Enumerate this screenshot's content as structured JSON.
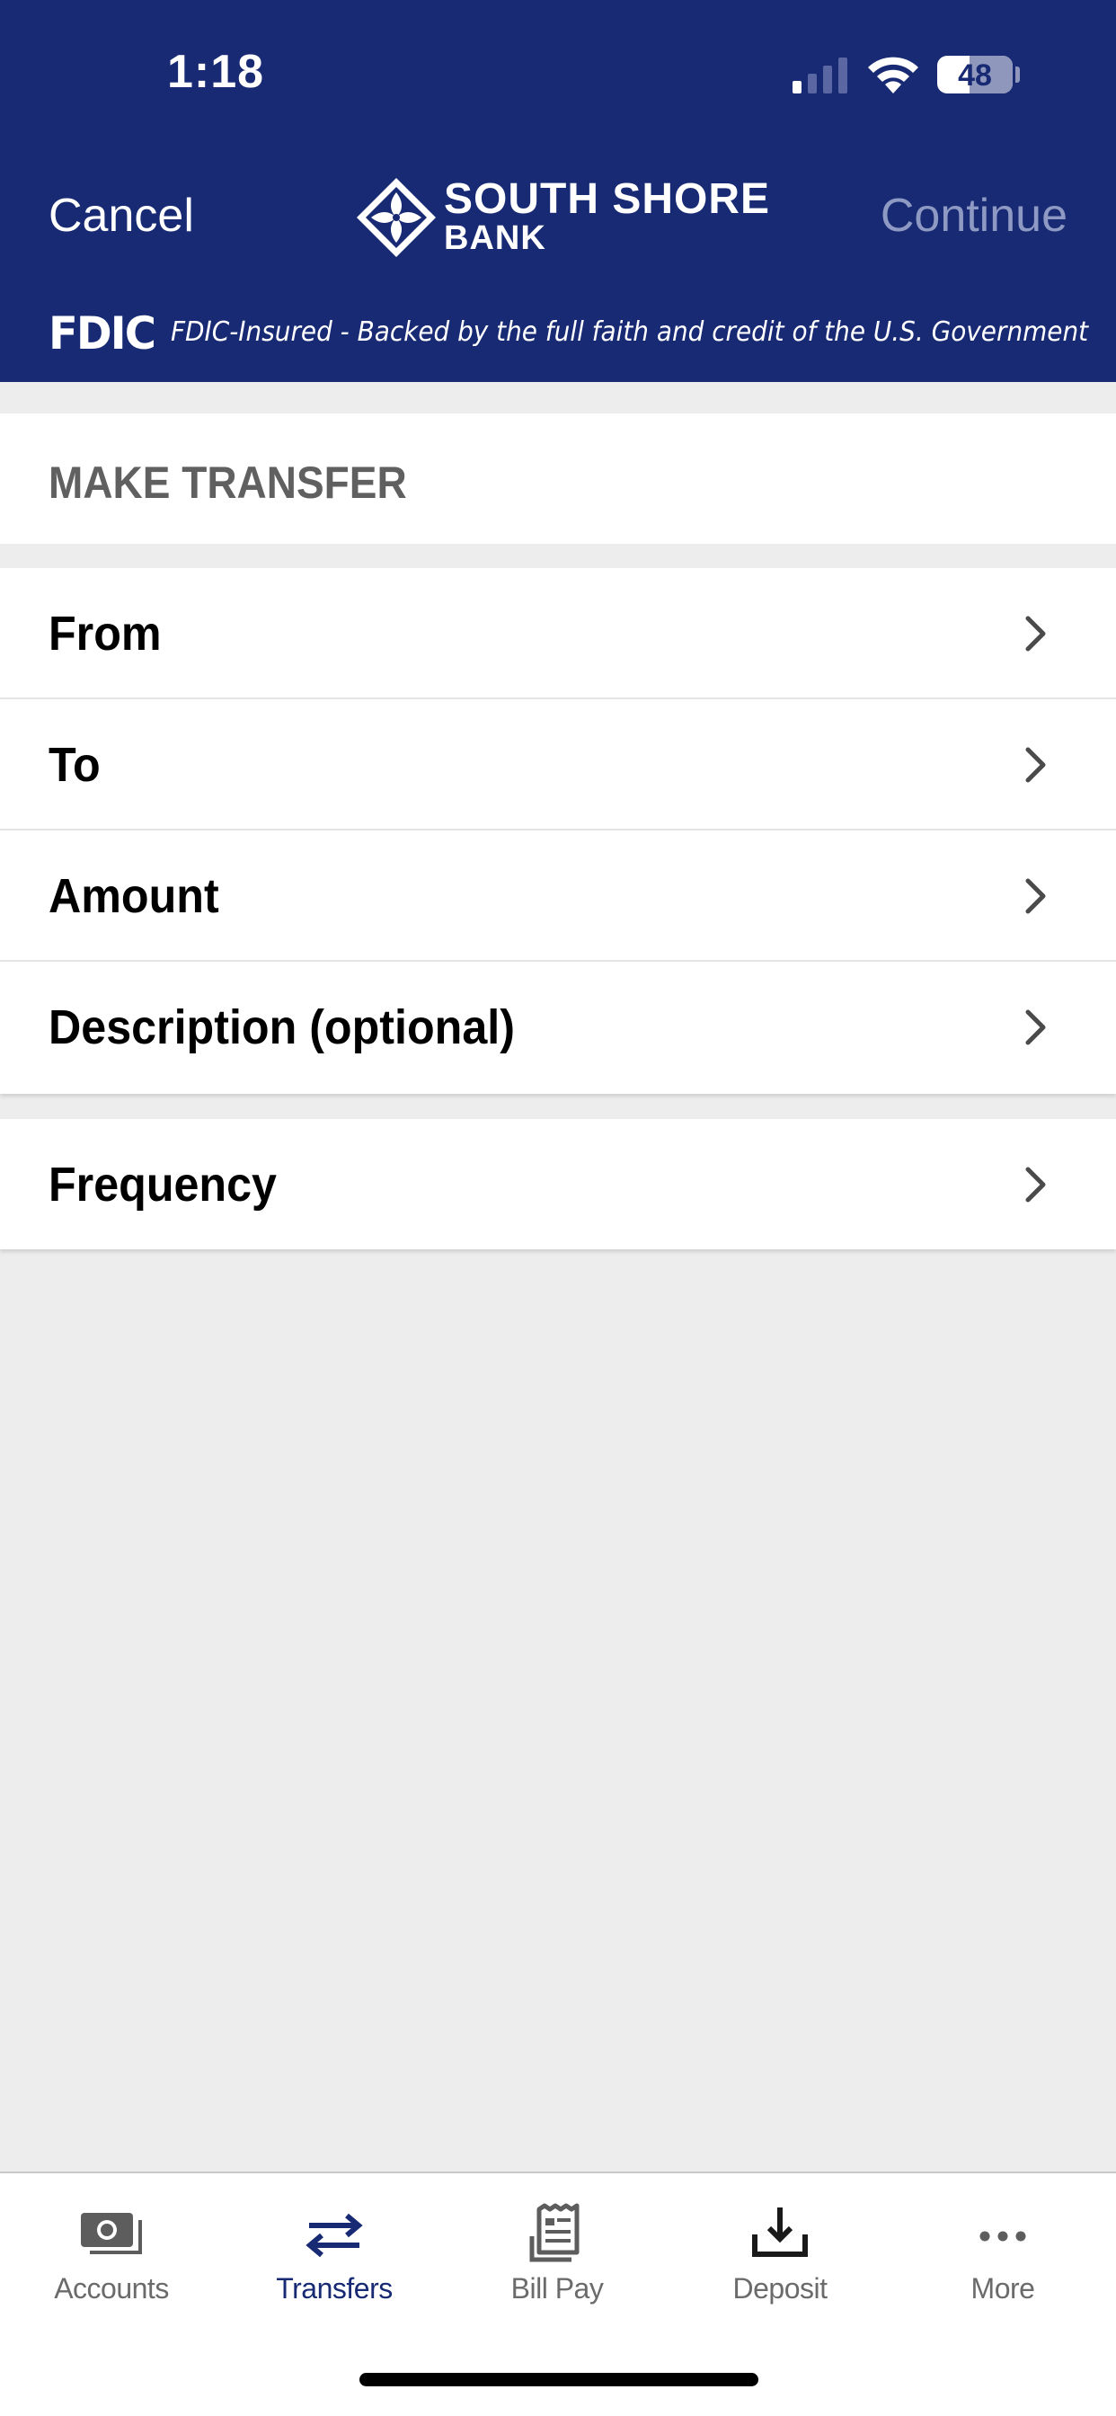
{
  "status_bar": {
    "time": "1:18",
    "battery_level": "48",
    "icons": [
      "cellular-signal-icon",
      "wifi-icon",
      "battery-icon"
    ]
  },
  "header": {
    "cancel_label": "Cancel",
    "continue_label": "Continue",
    "brand_line1": "SOUTH SHORE",
    "brand_line2": "BANK",
    "fdic_logo": "FDIC",
    "fdic_notice": "FDIC-Insured - Backed by the full faith and credit of the U.S. Government"
  },
  "main": {
    "section_title": "MAKE TRANSFER",
    "fields": [
      {
        "label": "From"
      },
      {
        "label": "To"
      },
      {
        "label": "Amount"
      },
      {
        "label": "Description (optional)"
      }
    ],
    "options": [
      {
        "label": "Frequency"
      }
    ]
  },
  "tabbar": {
    "tabs": [
      {
        "label": "Accounts",
        "icon": "accounts-icon",
        "active": false
      },
      {
        "label": "Transfers",
        "icon": "transfer-arrows-icon",
        "active": true
      },
      {
        "label": "Bill Pay",
        "icon": "bill-receipt-icon",
        "active": false
      },
      {
        "label": "Deposit",
        "icon": "deposit-download-icon",
        "active": false
      },
      {
        "label": "More",
        "icon": "more-dots-icon",
        "active": false
      }
    ]
  },
  "colors": {
    "header_bg": "#172a73",
    "active_tab": "#172a73",
    "continue_disabled": "#8e9ac3",
    "page_bg": "#ededed"
  }
}
